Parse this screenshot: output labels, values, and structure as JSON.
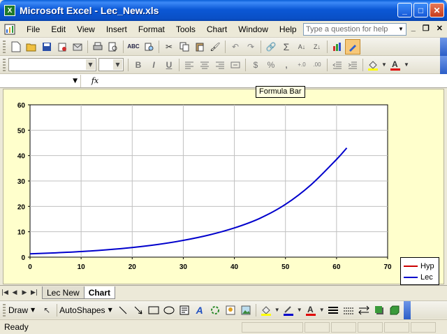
{
  "window": {
    "title": "Microsoft Excel - Lec_New.xls",
    "app_icon_letter": "X",
    "minimize": "_",
    "maximize": "□",
    "close": "✕"
  },
  "menubar": {
    "items": [
      "File",
      "Edit",
      "View",
      "Insert",
      "Format",
      "Tools",
      "Chart",
      "Window",
      "Help"
    ],
    "help_placeholder": "Type a question for help",
    "mdi_minimize": "_",
    "mdi_restore": "❐",
    "mdi_close": "✕"
  },
  "formatting": {
    "bold": "B",
    "italic": "I",
    "underline": "U",
    "currency": "$",
    "percent": "%",
    "comma": ",",
    "inc_decimal": "+.0",
    "dec_decimal": ".00"
  },
  "formula_bar": {
    "fx": "fx",
    "tooltip": "Formula Bar"
  },
  "chart_data": {
    "type": "line",
    "title": "",
    "xlabel": "",
    "ylabel": "",
    "xlim": [
      0,
      70
    ],
    "ylim": [
      0,
      60
    ],
    "x_ticks": [
      0,
      10,
      20,
      30,
      40,
      50,
      60,
      70
    ],
    "y_ticks": [
      0,
      10,
      20,
      30,
      40,
      50,
      60
    ],
    "grid": true,
    "legend_position": "right",
    "series": [
      {
        "name": "Hyp",
        "color": "#cc0000",
        "x": [],
        "y": []
      },
      {
        "name": "Lec",
        "color": "#0000cc",
        "x": [
          0,
          5,
          10,
          15,
          20,
          25,
          30,
          35,
          40,
          45,
          50,
          55,
          60,
          62
        ],
        "y": [
          1.3,
          1.7,
          2.2,
          2.9,
          3.8,
          5.0,
          6.6,
          8.7,
          11.5,
          15.3,
          20.8,
          28.5,
          38.5,
          43
        ]
      }
    ]
  },
  "sheet_tabs": {
    "tabs": [
      "Lec New",
      "Chart"
    ],
    "active": "Chart"
  },
  "drawing": {
    "draw_label": "Draw",
    "autoshapes_label": "AutoShapes"
  },
  "status": {
    "text": "Ready"
  },
  "colors": {
    "chart_area_bg": "#ffffcc",
    "title_bar": "#0b58d6"
  }
}
